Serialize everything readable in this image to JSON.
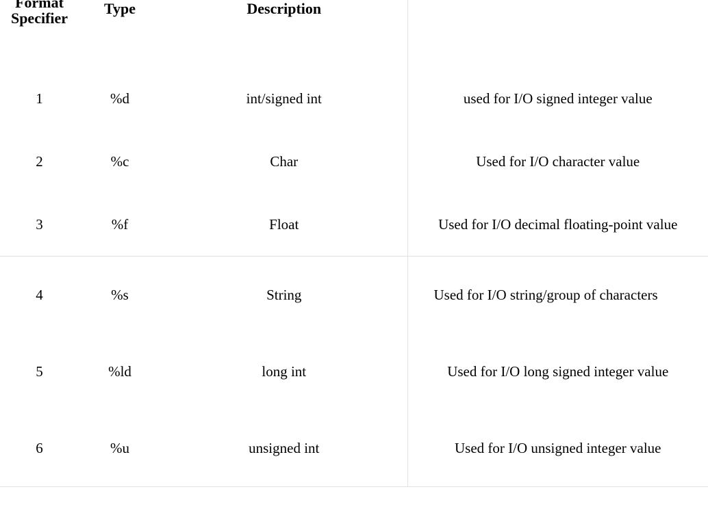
{
  "headers": {
    "index": "Format\nSpecifier",
    "type": "Type",
    "description": "Description",
    "usage": ""
  },
  "rows": [
    {
      "index": "1",
      "type": "%d",
      "description": "int/signed int",
      "usage": "used for I/O signed integer value"
    },
    {
      "index": "2",
      "type": "%c",
      "description": "Char",
      "usage": "Used for I/O character value"
    },
    {
      "index": "3",
      "type": "%f",
      "description": "Float",
      "usage": "Used for I/O decimal floating-point value"
    },
    {
      "index": "4",
      "type": "%s",
      "description": "String",
      "usage": "Used for I/O string/group of characters"
    },
    {
      "index": "5",
      "type": "%ld",
      "description": "long int",
      "usage": "Used for I/O long signed integer value"
    },
    {
      "index": "6",
      "type": "%u",
      "description": "unsigned int",
      "usage": "Used for I/O unsigned integer value"
    }
  ]
}
